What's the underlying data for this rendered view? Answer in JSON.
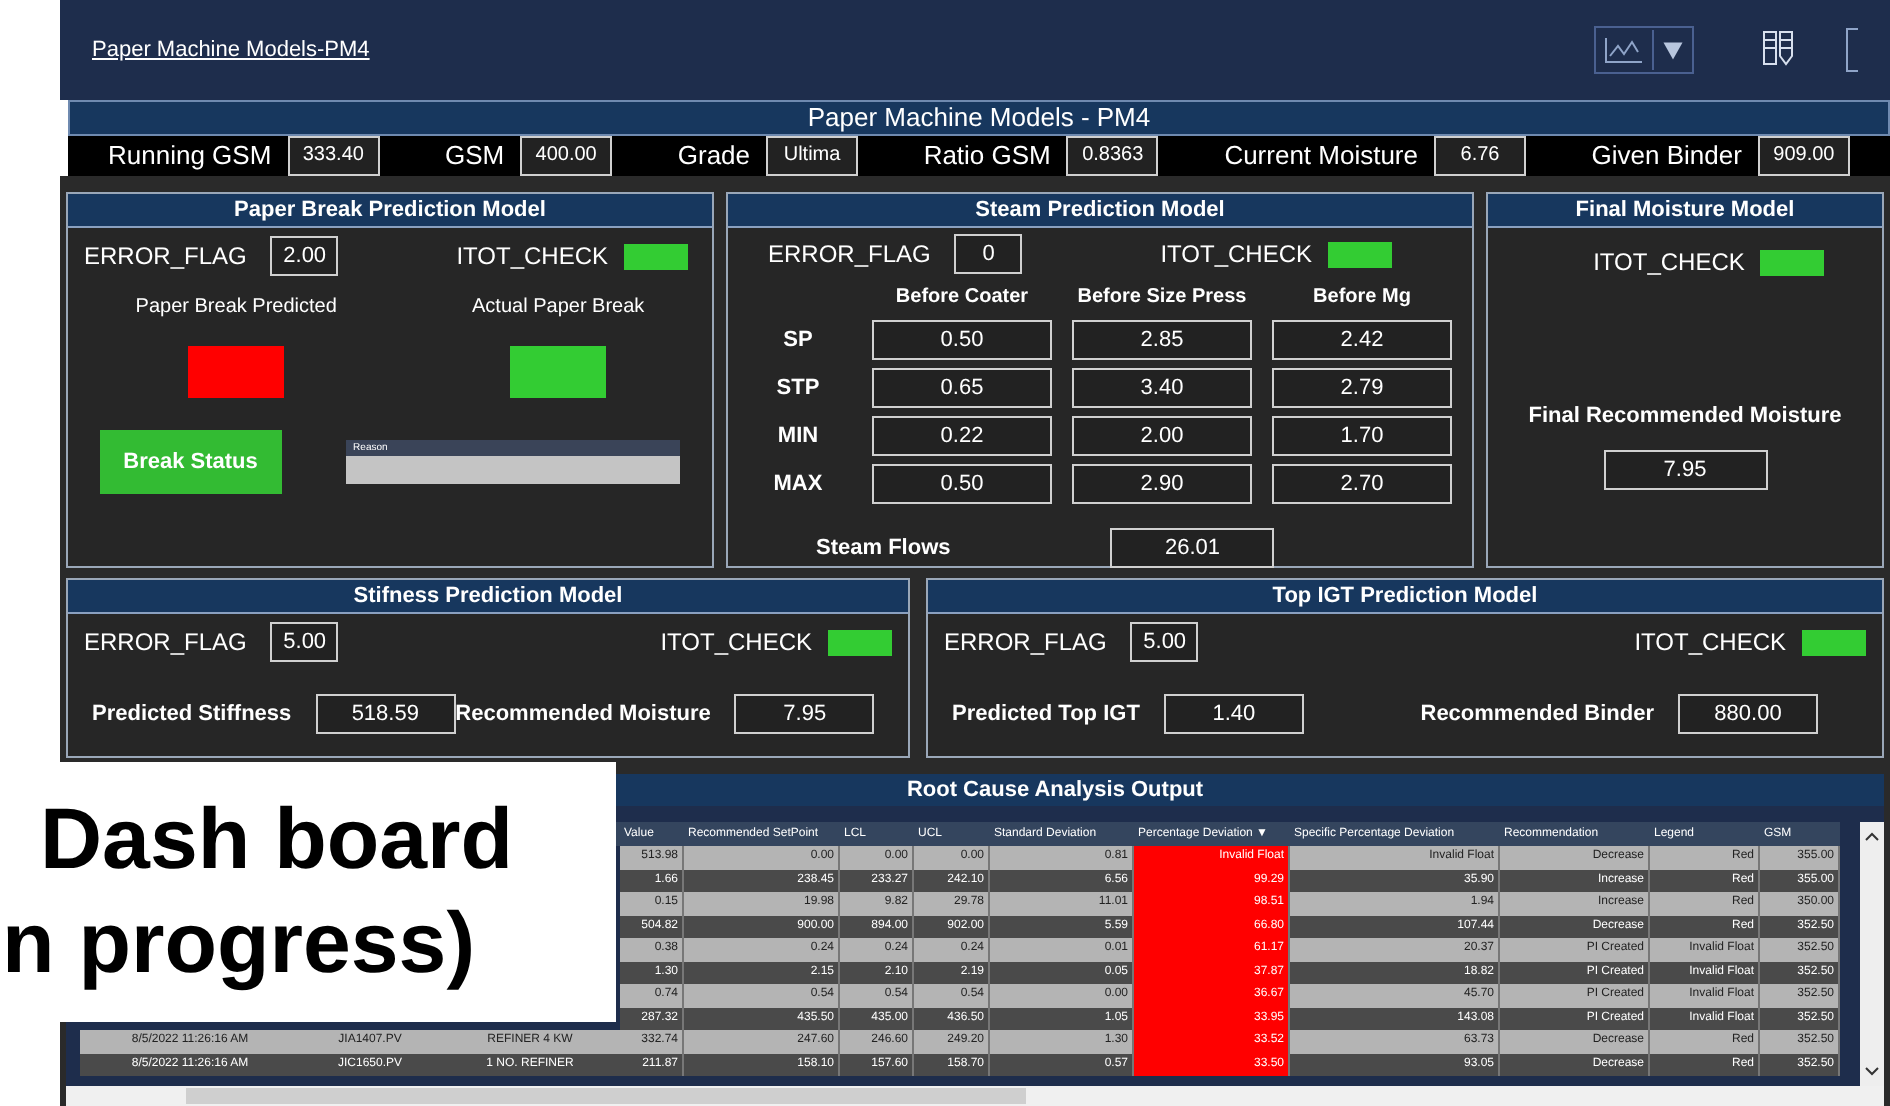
{
  "top_bar": {
    "link": "Paper Machine Models-PM4"
  },
  "header": {
    "title": "Paper Machine Models - PM4",
    "fields": [
      {
        "label": "Running GSM",
        "value": "333.40"
      },
      {
        "label": "GSM",
        "value": "400.00"
      },
      {
        "label": "Grade",
        "value": "Ultima"
      },
      {
        "label": "Ratio GSM",
        "value": "0.8363"
      },
      {
        "label": "Current Moisture",
        "value": "6.76"
      },
      {
        "label": "Given Binder",
        "value": "909.00"
      }
    ]
  },
  "paper_break": {
    "title": "Paper Break Prediction Model",
    "error_flag_label": "ERROR_FLAG",
    "error_flag": "2.00",
    "itot_label": "ITOT_CHECK",
    "itot_ok": true,
    "indicators": [
      {
        "label": "Paper Break Predicted",
        "color": "#ff0000"
      },
      {
        "label": "Actual Paper Break",
        "color": "#33cc33"
      }
    ],
    "button": "Break Status",
    "reason_label": "Reason"
  },
  "steam": {
    "title": "Steam Prediction Model",
    "error_flag_label": "ERROR_FLAG",
    "error_flag": "0",
    "itot_label": "ITOT_CHECK",
    "itot_ok": true,
    "columns": [
      "Before Coater",
      "Before Size Press",
      "Before Mg"
    ],
    "rows": [
      {
        "label": "SP",
        "values": [
          "0.50",
          "2.85",
          "2.42"
        ]
      },
      {
        "label": "STP",
        "values": [
          "0.65",
          "3.40",
          "2.79"
        ]
      },
      {
        "label": "MIN",
        "values": [
          "0.22",
          "2.00",
          "1.70"
        ]
      },
      {
        "label": "MAX",
        "values": [
          "0.50",
          "2.90",
          "2.70"
        ]
      }
    ],
    "flows_label": "Steam Flows",
    "flows": "26.01"
  },
  "final_moisture": {
    "title": "Final Moisture Model",
    "itot_label": "ITOT_CHECK",
    "itot_ok": true,
    "label": "Final Recommended Moisture",
    "value": "7.95"
  },
  "stiffness": {
    "title": "Stifness Prediction Model",
    "error_flag_label": "ERROR_FLAG",
    "error_flag": "5.00",
    "itot_label": "ITOT_CHECK",
    "itot_ok": true,
    "outputs": [
      {
        "label": "Predicted Stiffness",
        "value": "518.59"
      },
      {
        "label": "Recommended Moisture",
        "value": "7.95"
      }
    ]
  },
  "top_igt": {
    "title": "Top IGT Prediction Model",
    "error_flag_label": "ERROR_FLAG",
    "error_flag": "5.00",
    "itot_label": "ITOT_CHECK",
    "itot_ok": true,
    "outputs": [
      {
        "label": "Predicted Top IGT",
        "value": "1.40"
      },
      {
        "label": "Recommended Binder",
        "value": "880.00"
      }
    ]
  },
  "root_cause": {
    "title": "Root Cause Analysis Output",
    "sort_mark": "▼",
    "columns": [
      {
        "label": "Value",
        "sorted": false,
        "highlighted": false
      },
      {
        "label": "Recommended SetPoint",
        "sorted": false,
        "highlighted": false
      },
      {
        "label": "LCL",
        "sorted": false,
        "highlighted": false
      },
      {
        "label": "UCL",
        "sorted": false,
        "highlighted": false
      },
      {
        "label": "Standard Deviation",
        "sorted": false,
        "highlighted": false
      },
      {
        "label": "Percentage Deviation",
        "sorted": true,
        "highlighted": true
      },
      {
        "label": "Specific Percentage Deviation",
        "sorted": false,
        "highlighted": false
      },
      {
        "label": "Recommendation",
        "sorted": false,
        "highlighted": false
      },
      {
        "label": "Legend",
        "sorted": false,
        "highlighted": false
      },
      {
        "label": "GSM",
        "sorted": false,
        "highlighted": false
      }
    ],
    "rows": [
      {
        "cells": [
          "513.98",
          "0.00",
          "0.00",
          "0.00",
          "0.81",
          "Invalid Float",
          "Invalid Float",
          "Decrease",
          "Red",
          "355.00"
        ]
      },
      {
        "cells": [
          "1.66",
          "238.45",
          "233.27",
          "242.10",
          "6.56",
          "99.29",
          "35.90",
          "Increase",
          "Red",
          "355.00"
        ]
      },
      {
        "cells": [
          "0.15",
          "19.98",
          "9.82",
          "29.78",
          "11.01",
          "98.51",
          "1.94",
          "Increase",
          "Red",
          "350.00"
        ]
      },
      {
        "cells": [
          "504.82",
          "900.00",
          "894.00",
          "902.00",
          "5.59",
          "66.80",
          "107.44",
          "Decrease",
          "Red",
          "352.50"
        ]
      },
      {
        "cells": [
          "0.38",
          "0.24",
          "0.24",
          "0.24",
          "0.01",
          "61.17",
          "20.37",
          "PI Created",
          "Invalid Float",
          "352.50"
        ]
      },
      {
        "cells": [
          "1.30",
          "2.15",
          "2.10",
          "2.19",
          "0.05",
          "37.87",
          "18.82",
          "PI Created",
          "Invalid Float",
          "352.50"
        ]
      },
      {
        "cells": [
          "0.74",
          "0.54",
          "0.54",
          "0.54",
          "0.00",
          "36.67",
          "45.70",
          "PI Created",
          "Invalid Float",
          "352.50"
        ]
      },
      {
        "cells": [
          "287.32",
          "435.50",
          "435.00",
          "436.50",
          "1.05",
          "33.95",
          "143.08",
          "PI Created",
          "Invalid Float",
          "352.50"
        ]
      },
      {
        "time": "8/5/2022 11:26:16 AM",
        "tag": "JIA1407.PV",
        "description": "REFINER 4 KW",
        "cells": [
          "332.74",
          "247.60",
          "246.60",
          "249.20",
          "1.30",
          "33.52",
          "63.73",
          "Decrease",
          "Red",
          "352.50"
        ]
      },
      {
        "time": "8/5/2022 11:26:16 AM",
        "tag": "JIC1650.PV",
        "description": "1 NO. REFINER",
        "cells": [
          "211.87",
          "158.10",
          "157.60",
          "158.70",
          "0.57",
          "33.50",
          "93.05",
          "Decrease",
          "Red",
          "352.50"
        ]
      }
    ]
  },
  "overlay": {
    "lines": [
      "Dash board",
      "n progress)"
    ]
  }
}
